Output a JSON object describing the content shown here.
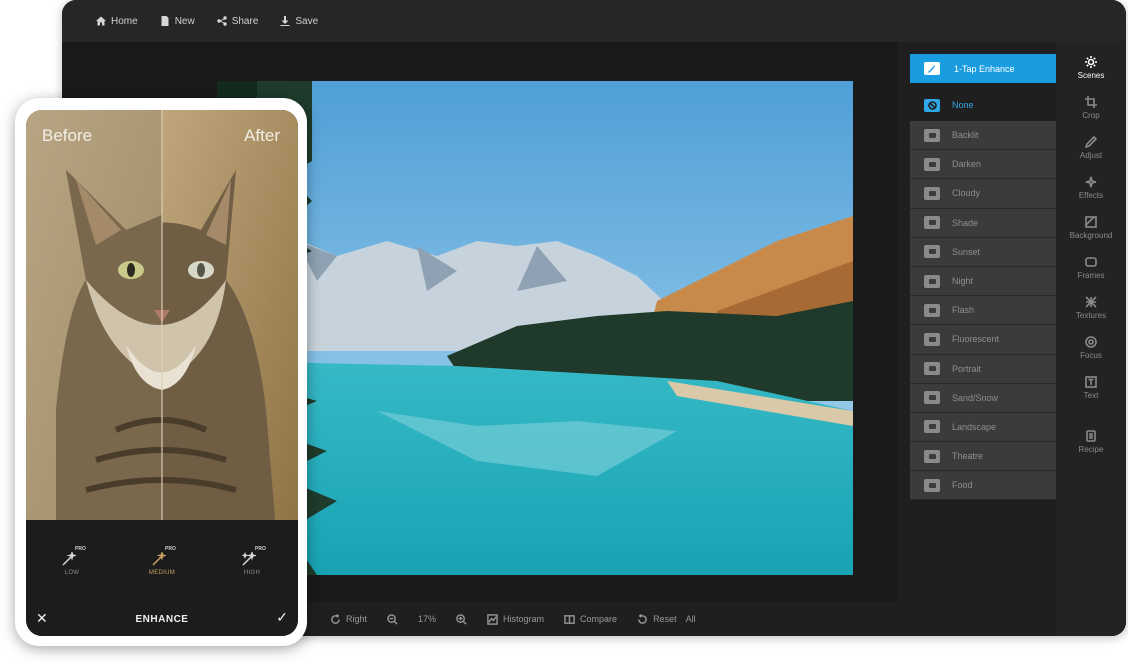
{
  "toolbar": {
    "home": "Home",
    "new": "New",
    "share": "Share",
    "save": "Save"
  },
  "bottom": {
    "right": "Right",
    "zoom": "17%",
    "histogram": "Histogram",
    "compare": "Compare",
    "reset": "Reset",
    "all": "All"
  },
  "scenes": {
    "enhance": "1-Tap Enhance",
    "none": "None",
    "items": [
      "Backlit",
      "Darken",
      "Cloudy",
      "Shade",
      "Sunset",
      "Night",
      "Flash",
      "Fluorescent",
      "Portrait",
      "Sand/Snow",
      "Landscape",
      "Theatre",
      "Food"
    ]
  },
  "tools": [
    {
      "label": "Scenes",
      "icon": "sun-icon",
      "active": true
    },
    {
      "label": "Crop",
      "icon": "crop-icon"
    },
    {
      "label": "Adjust",
      "icon": "pen-icon"
    },
    {
      "label": "Effects",
      "icon": "sparkle-icon"
    },
    {
      "label": "Background",
      "icon": "background-icon"
    },
    {
      "label": "Frames",
      "icon": "frame-icon"
    },
    {
      "label": "Textures",
      "icon": "texture-icon"
    },
    {
      "label": "Focus",
      "icon": "focus-icon"
    },
    {
      "label": "Text",
      "icon": "text-icon"
    },
    {
      "label": "Recipe",
      "icon": "recipe-icon"
    }
  ],
  "phone": {
    "before": "Before",
    "after": "After",
    "levels": [
      {
        "label": "LOW",
        "badge": "PRO"
      },
      {
        "label": "MEDIUM",
        "badge": "PRO"
      },
      {
        "label": "HIGH",
        "badge": "PRO"
      }
    ],
    "title": "ENHANCE",
    "close": "✕",
    "confirm": "✓"
  },
  "colors": {
    "accent": "#1a9de0",
    "selected_level": "#c9a262"
  }
}
